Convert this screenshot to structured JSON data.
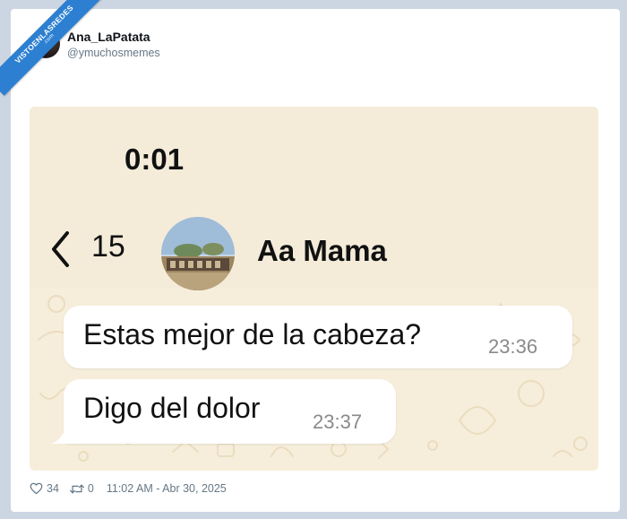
{
  "watermark": {
    "text": "VISTOENLASREDES",
    "sub": ".com"
  },
  "tweet": {
    "author_name": "Ana_LaPatata",
    "author_handle": "@ymuchosmemes",
    "likes": "34",
    "retweets": "0",
    "timestamp": "11:02 AM - Abr 30, 2025"
  },
  "chat": {
    "clock": "0:01",
    "back_count": "15",
    "contact_name": "Aa Mama",
    "messages": [
      {
        "text": "Estas mejor de la cabeza?",
        "time": "23:36"
      },
      {
        "text": "Digo del dolor",
        "time": "23:37"
      }
    ]
  },
  "icons": {
    "back": "chevron-left-icon",
    "like": "heart-icon",
    "retweet": "retweet-icon"
  },
  "colors": {
    "page_bg": "#ccd6e3",
    "chat_bg": "#f6eedb",
    "bubble": "#ffffff",
    "ribbon": "#2c7fd1"
  }
}
